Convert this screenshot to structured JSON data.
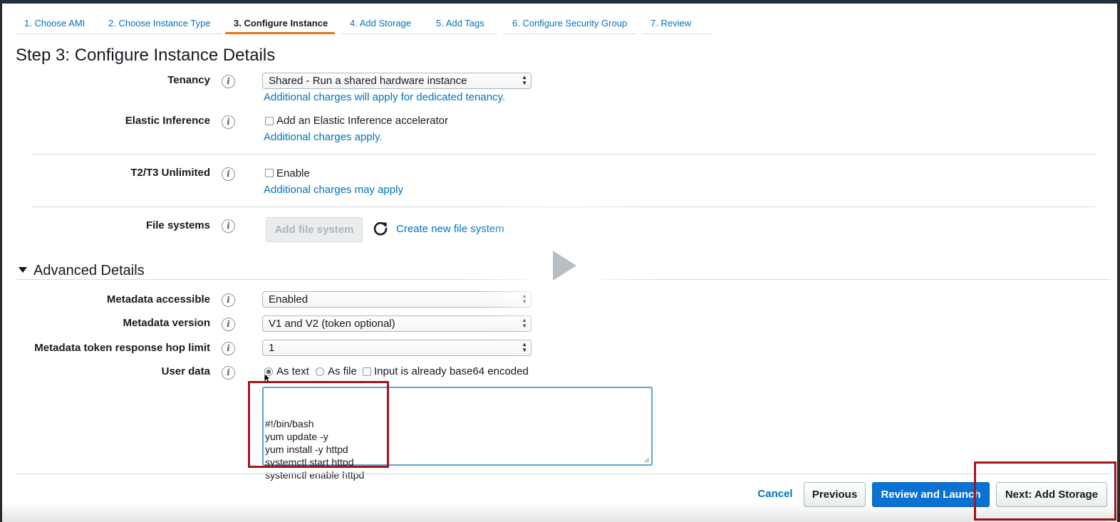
{
  "tabs": [
    {
      "label": "1. Choose AMI",
      "active": false
    },
    {
      "label": "2. Choose Instance Type",
      "active": false
    },
    {
      "label": "3. Configure Instance",
      "active": true
    },
    {
      "label": "4. Add Storage",
      "active": false
    },
    {
      "label": "5. Add Tags",
      "active": false
    },
    {
      "label": "6. Configure Security Group",
      "active": false
    },
    {
      "label": "7. Review",
      "active": false
    }
  ],
  "page_title": "Step 3: Configure Instance Details",
  "info_glyph": "i",
  "tenancy": {
    "label": "Tenancy",
    "value": "Shared - Run a shared hardware instance",
    "note": "Additional charges will apply for dedicated tenancy."
  },
  "elastic_inference": {
    "label": "Elastic Inference",
    "checkbox_label": "Add an Elastic Inference accelerator",
    "checked": false,
    "note": "Additional charges apply."
  },
  "t2t3_unlimited": {
    "label": "T2/T3 Unlimited",
    "checkbox_label": "Enable",
    "checked": false,
    "note": "Additional charges may apply"
  },
  "file_systems": {
    "label": "File systems",
    "add_button": "Add file system",
    "create_link": "Create new file system"
  },
  "advanced": {
    "header": "Advanced Details",
    "metadata_accessible": {
      "label": "Metadata accessible",
      "value": "Enabled"
    },
    "metadata_version": {
      "label": "Metadata version",
      "value": "V1 and V2 (token optional)"
    },
    "hop_limit": {
      "label": "Metadata token response hop limit",
      "value": "1"
    },
    "user_data": {
      "label": "User data",
      "options": {
        "as_text": "As text",
        "as_file": "As file",
        "base64": "Input is already base64 encoded"
      },
      "selected": "As text",
      "lines": [
        "#!/bin/bash",
        "yum update -y",
        "yum install -y httpd",
        "systemctl start httpd",
        "systemctl enable httpd"
      ]
    }
  },
  "footer": {
    "cancel": "Cancel",
    "previous": "Previous",
    "review_launch": "Review and Launch",
    "next": "Next: Add Storage"
  },
  "colors": {
    "link": "#0073bb",
    "primary_button": "#0972d3",
    "active_tab_underline": "#ec7211",
    "highlight": "#a4161a"
  }
}
